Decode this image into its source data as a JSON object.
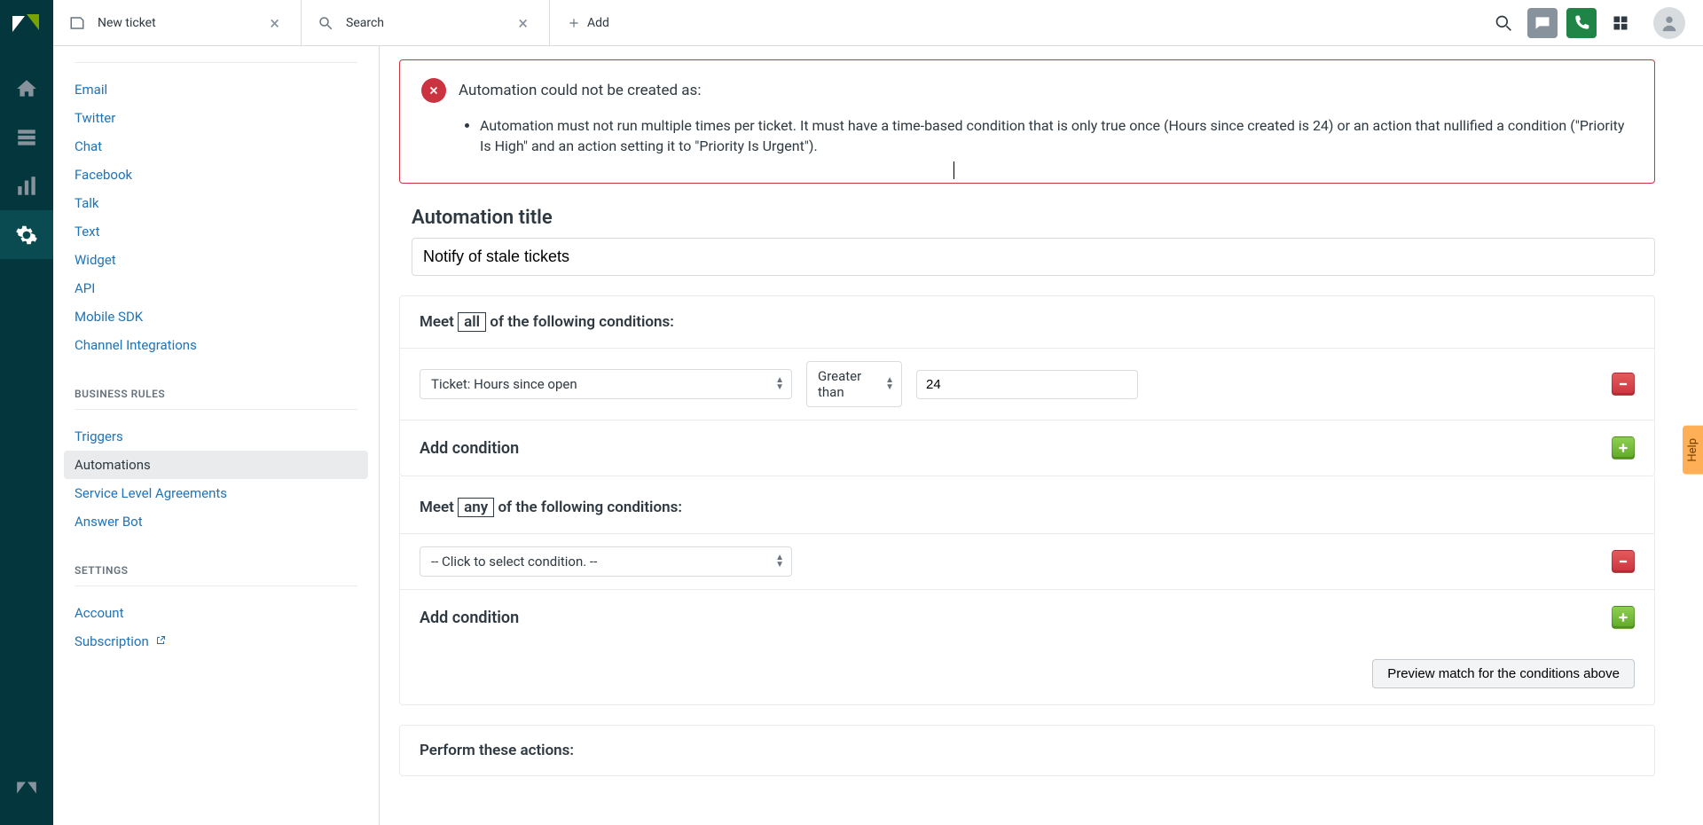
{
  "tabs": {
    "t0_label": "New ticket",
    "t1_label": "Search",
    "add_label": "Add"
  },
  "rail": {
    "home": "home-icon",
    "views": "views-icon",
    "reporting": "reporting-icon",
    "admin": "admin-icon"
  },
  "sidebar": {
    "channels": {
      "email": "Email",
      "twitter": "Twitter",
      "chat": "Chat",
      "facebook": "Facebook",
      "talk": "Talk",
      "text": "Text",
      "widget": "Widget",
      "api": "API",
      "mobilesdk": "Mobile SDK",
      "channel_integrations": "Channel Integrations"
    },
    "business_rules_heading": "BUSINESS RULES",
    "business_rules": {
      "triggers": "Triggers",
      "automations": "Automations",
      "sla": "Service Level Agreements",
      "answer_bot": "Answer Bot"
    },
    "settings_heading": "SETTINGS",
    "settings": {
      "account": "Account",
      "subscription": "Subscription"
    }
  },
  "error": {
    "title": "Automation could not be created as:",
    "item1": "Automation must not run multiple times per ticket. It must have a time-based condition that is only true once (Hours since created is 24) or an action that nullified a condition (\"Priority Is High\" and an action setting it to \"Priority Is Urgent\")."
  },
  "form": {
    "automation_title_label": "Automation title",
    "automation_title_value": "Notify of stale tickets",
    "meet_prefix": "Meet",
    "all_tag": "all",
    "any_tag": "any",
    "cond_suffix": "of the following conditions:",
    "cond1_field": "Ticket: Hours since open",
    "cond1_op": "Greater than",
    "cond1_value": "24",
    "cond_placeholder": "-- Click to select condition. --",
    "add_condition": "Add condition",
    "preview_button": "Preview match for the conditions above",
    "perform_heading": "Perform these actions:"
  },
  "help_tab": "Help"
}
